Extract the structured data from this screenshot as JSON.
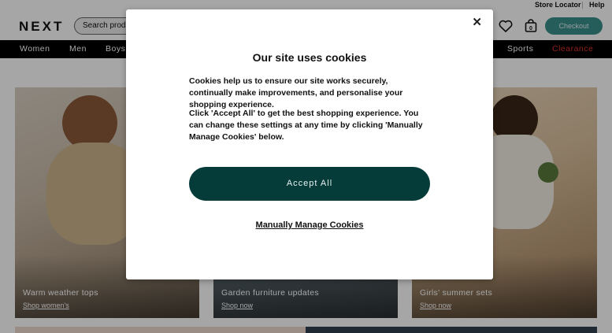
{
  "utility_bar": {
    "store_locator": "Store Locator",
    "help": "Help"
  },
  "header": {
    "logo": "NEXT",
    "search_placeholder": "Search product",
    "wishlist_icon": "heart-icon",
    "bag_icon": "shopping-bag-icon",
    "checkout_label": "Checkout"
  },
  "nav": {
    "items": [
      "Women",
      "Men",
      "Boys",
      "Sports",
      "Clearance"
    ]
  },
  "tiles": [
    {
      "title": "Warm weather tops",
      "link": "Shop women's"
    },
    {
      "title": "Garden furniture updates",
      "link": "Shop now"
    },
    {
      "title": "Girls' summer sets",
      "link": "Shop now"
    }
  ],
  "cookie_modal": {
    "title": "Our site uses cookies",
    "paragraph_1": "Cookies help us to ensure our site works securely, continually make improvements, and personalise your shopping experience.",
    "paragraph_2": "Click 'Accept All' to get the best shopping experience. You can change these settings at any time by clicking 'Manually Manage Cookies' below.",
    "accept_label": "Accept All",
    "manage_label": "Manually Manage Cookies",
    "close_icon": "close-icon"
  },
  "colors": {
    "nav_background": "#000000",
    "clearance": "#e0322c",
    "checkout": "#3a8f8b",
    "accept_button": "#053c3a"
  }
}
